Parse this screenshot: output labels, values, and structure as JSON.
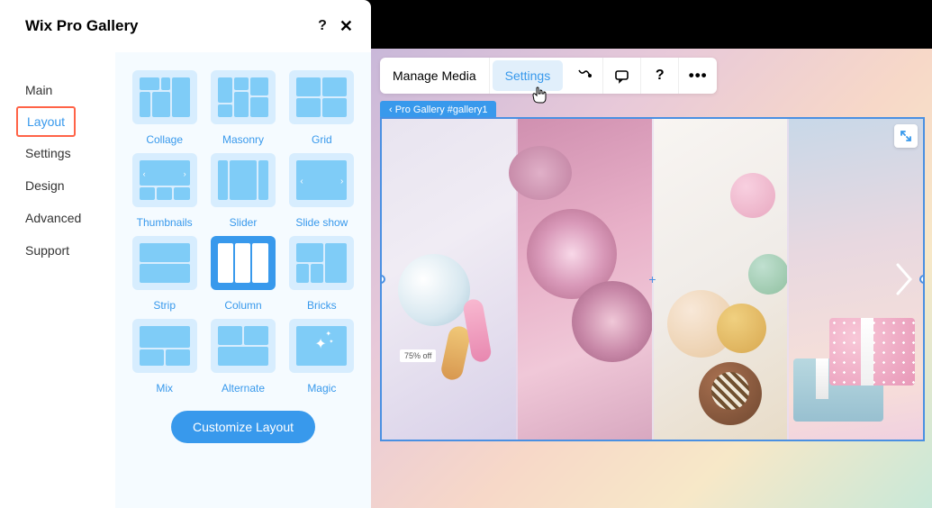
{
  "panel": {
    "title": "Wix Pro Gallery",
    "sidebar": {
      "items": [
        {
          "label": "Main"
        },
        {
          "label": "Layout"
        },
        {
          "label": "Settings"
        },
        {
          "label": "Design"
        },
        {
          "label": "Advanced"
        },
        {
          "label": "Support"
        }
      ],
      "active_index": 1
    },
    "layouts": [
      {
        "label": "Collage"
      },
      {
        "label": "Masonry"
      },
      {
        "label": "Grid"
      },
      {
        "label": "Thumbnails"
      },
      {
        "label": "Slider"
      },
      {
        "label": "Slide show"
      },
      {
        "label": "Strip"
      },
      {
        "label": "Column"
      },
      {
        "label": "Bricks"
      },
      {
        "label": "Mix"
      },
      {
        "label": "Alternate"
      },
      {
        "label": "Magic"
      }
    ],
    "selected_layout_index": 7,
    "customize_button": "Customize Layout"
  },
  "toolbar": {
    "manage_media": "Manage Media",
    "settings": "Settings"
  },
  "breadcrumb": {
    "label": "‹ Pro Gallery #gallery1"
  },
  "icons": {
    "help": "?",
    "close": "✕",
    "dots": "•••"
  },
  "gallery": {
    "sale_text": "75% off"
  },
  "colors": {
    "accent": "#3899ec",
    "highlight_border": "#ff6347",
    "selection_blue": "#4a90e2"
  }
}
